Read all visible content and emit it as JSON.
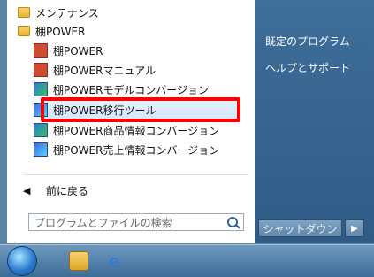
{
  "start_menu": {
    "programs": [
      {
        "label": "メンテナンス",
        "icon": "folder-icon"
      },
      {
        "label": "棚POWER",
        "icon": "folder-icon"
      },
      {
        "label": "棚POWER",
        "icon": "app-icon"
      },
      {
        "label": "棚POWERマニュアル",
        "icon": "manual-icon"
      },
      {
        "label": "棚POWERモデルコンバージョン",
        "icon": "converter-icon"
      },
      {
        "label": "棚POWER移行ツール",
        "icon": "migration-tool-icon",
        "highlighted": true
      },
      {
        "label": "棚POWER商品情報コンバージョン",
        "icon": "converter-icon"
      },
      {
        "label": "棚POWER売上情報コンバージョン",
        "icon": "converter-icon"
      }
    ],
    "back_label": "前に戻る",
    "search_placeholder": "プログラムとファイルの検索",
    "right_links": [
      "既定のプログラム",
      "ヘルプとサポート"
    ],
    "shutdown_label": "シャットダウン"
  },
  "taskbar": {
    "icons": [
      "start-orb-icon",
      "windows-explorer-icon",
      "internet-explorer-icon"
    ]
  },
  "colors": {
    "highlight_border": "#ff0000",
    "right_panel": "#2f5b86"
  }
}
